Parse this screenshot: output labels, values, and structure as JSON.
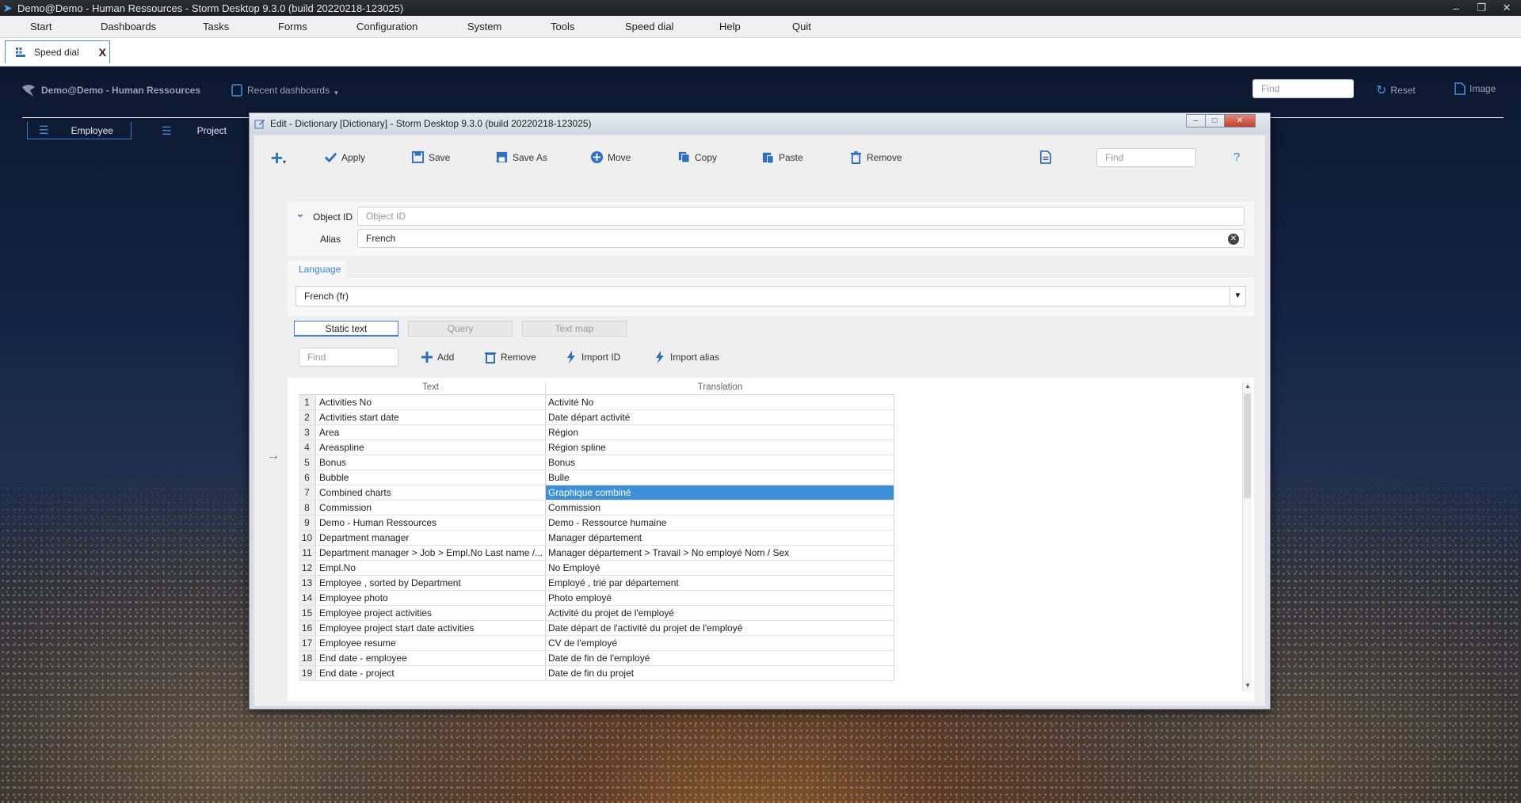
{
  "os": {
    "title": "Demo@Demo - Human Ressources -  Storm Desktop 9.3.0 (build 20220218-123025)"
  },
  "menu": [
    "Start",
    "Dashboards",
    "Tasks",
    "Forms",
    "Configuration",
    "System",
    "Tools",
    "Speed dial",
    "Help",
    "Quit"
  ],
  "tab": {
    "label": "Speed dial",
    "close": "X"
  },
  "dashboard": {
    "title": "Demo@Demo - Human Ressources",
    "recent": "Recent dashboards",
    "find_placeholder": "Find",
    "reset": "Reset",
    "image": "Image",
    "tabs": [
      "Employee",
      "Project"
    ]
  },
  "dialog": {
    "title": "Edit - Dictionary [Dictionary] -  Storm Desktop 9.3.0 (build 20220218-123025)",
    "toolbar": {
      "apply": "Apply",
      "save": "Save",
      "save_as": "Save As",
      "move": "Move",
      "copy": "Copy",
      "paste": "Paste",
      "remove": "Remove",
      "find_placeholder": "Find",
      "help": "?"
    },
    "object_id_label": "Object ID",
    "object_id_placeholder": "Object ID",
    "alias_label": "Alias",
    "alias_value": "French",
    "language_tab": "Language",
    "language_value": "French (fr)",
    "subtabs": [
      "Static text",
      "Query",
      "Text map"
    ],
    "grid_toolbar": {
      "find_placeholder": "Find",
      "add": "Add",
      "remove": "Remove",
      "import_id": "Import ID",
      "import_alias": "Import alias"
    },
    "columns": {
      "text": "Text",
      "translation": "Translation"
    },
    "rows": [
      {
        "n": "1",
        "text": "Activities No",
        "tr": "Activité No"
      },
      {
        "n": "2",
        "text": "Activities start date",
        "tr": "Date départ activité"
      },
      {
        "n": "3",
        "text": "Area",
        "tr": "Région"
      },
      {
        "n": "4",
        "text": "Areaspline",
        "tr": "Région spline"
      },
      {
        "n": "5",
        "text": "Bonus",
        "tr": "Bonus"
      },
      {
        "n": "6",
        "text": "Bubble",
        "tr": "Bulle"
      },
      {
        "n": "7",
        "text": "Combined charts",
        "tr": "Graphique combiné"
      },
      {
        "n": "8",
        "text": "Commission",
        "tr": "Commission"
      },
      {
        "n": "9",
        "text": "Demo - Human Ressources",
        "tr": "Demo - Ressource humaine"
      },
      {
        "n": "10",
        "text": "Department manager",
        "tr": "Manager département"
      },
      {
        "n": "11",
        "text": "Department manager > Job > Empl.No Last name /...",
        "tr": "Manager département > Travail > No employé Nom / Sex"
      },
      {
        "n": "12",
        "text": "Empl.No",
        "tr": "No Employé"
      },
      {
        "n": "13",
        "text": "Employee , sorted by Department",
        "tr": "Employé , trié par département"
      },
      {
        "n": "14",
        "text": "Employee photo",
        "tr": "Photo employé"
      },
      {
        "n": "15",
        "text": "Employee project activities",
        "tr": "Activité du projet de l'employé"
      },
      {
        "n": "16",
        "text": "Employee project start date activities",
        "tr": "Date départ de l'activité du projet de l'employé"
      },
      {
        "n": "17",
        "text": "Employee resume",
        "tr": "CV de l'employé"
      },
      {
        "n": "18",
        "text": "End date - employee",
        "tr": "Date de fin de l'employé"
      },
      {
        "n": "19",
        "text": "End date - project",
        "tr": "Date de fin du projet"
      }
    ],
    "selected_row": 7
  },
  "colors": {
    "accent": "#3d8fd6",
    "selection": "#3d8fd6",
    "icon_blue": "#2f6fc0"
  }
}
